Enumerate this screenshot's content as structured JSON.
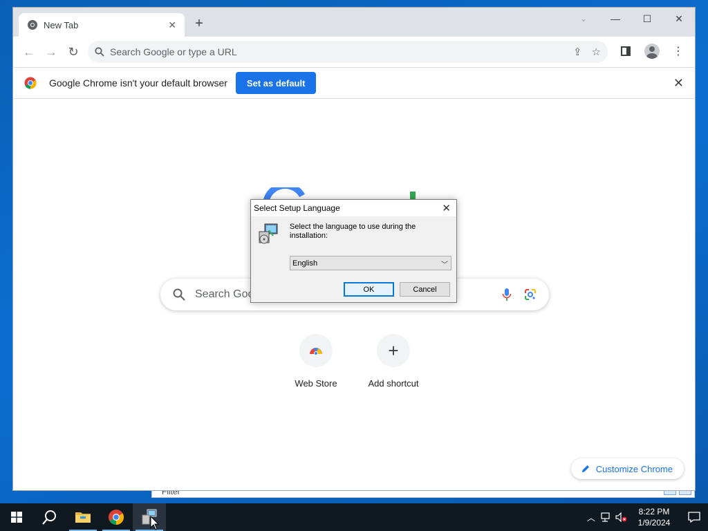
{
  "browser": {
    "tab": {
      "title": "New Tab"
    },
    "omnibox": {
      "placeholder": "Search Google or type a URL"
    },
    "infobar": {
      "message": "Google Chrome isn't your default browser",
      "button": "Set as default"
    }
  },
  "ntp": {
    "search_placeholder": "Search Google or type a URL",
    "shortcuts": [
      {
        "label": "Web Store",
        "icon": "web-store-icon"
      },
      {
        "label": "Add shortcut",
        "icon": "plus-icon"
      }
    ],
    "customize_label": "Customize Chrome"
  },
  "dialog": {
    "title": "Select Setup Language",
    "message": "Select the language to use during the installation:",
    "language": "English",
    "ok_label": "OK",
    "cancel_label": "Cancel"
  },
  "background_window": {
    "text": "Filter"
  },
  "taskbar": {
    "items": [
      "start-icon",
      "search-icon",
      "file-explorer-icon",
      "chrome-icon",
      "setup-installer-icon"
    ],
    "time": "8:22 PM",
    "date": "1/9/2024"
  },
  "colors": {
    "accent": "#1a73e8",
    "desktop": "#0b6fd0",
    "taskbar": "#101820"
  }
}
